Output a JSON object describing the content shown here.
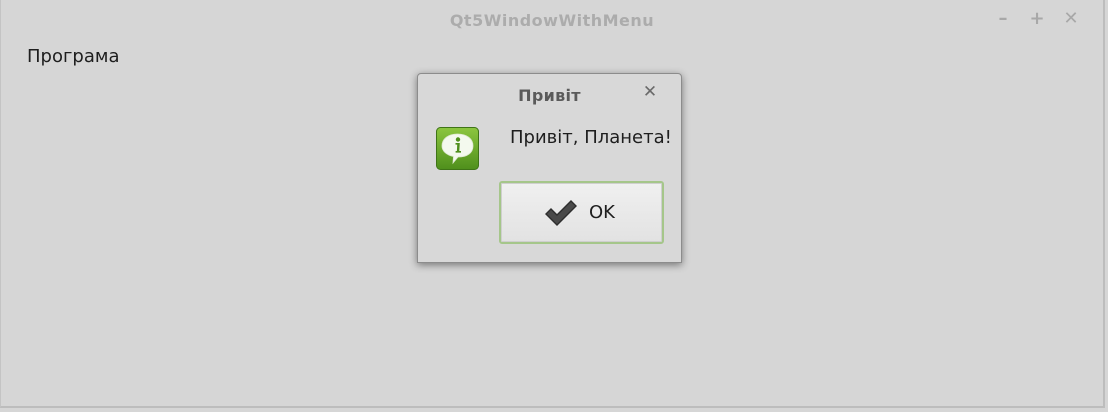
{
  "window": {
    "title": "Qt5WindowWithMenu",
    "controls": {
      "minimize": "–",
      "maximize": "+",
      "close": "✕"
    }
  },
  "menubar": {
    "items": [
      {
        "label": "Програма"
      }
    ]
  },
  "dialog": {
    "title": "Привіт",
    "close_glyph": "✕",
    "icon": "information-icon",
    "message": "Привіт, Планета!",
    "ok_button": {
      "label": "OK",
      "icon": "checkmark-icon"
    }
  },
  "colors": {
    "window_bg": "#d6d6d6",
    "info_icon_green": "#6aab2a",
    "button_focus_border": "#a5c68a"
  }
}
